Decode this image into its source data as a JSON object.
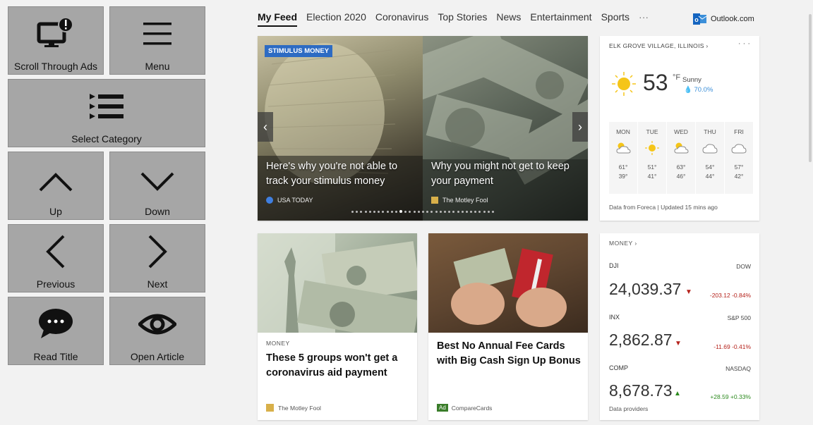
{
  "controls": {
    "scroll_ads": "Scroll Through Ads",
    "menu": "Menu",
    "select_category": "Select Category",
    "up": "Up",
    "down": "Down",
    "previous": "Previous",
    "next": "Next",
    "read_title": "Read Title",
    "open_article": "Open Article"
  },
  "nav": {
    "tabs": [
      "My Feed",
      "Election 2020",
      "Coronavirus",
      "Top Stories",
      "News",
      "Entertainment",
      "Sports"
    ],
    "more": "···",
    "outlook": "Outlook.com"
  },
  "hero": {
    "tag": "STIMULUS MONEY",
    "slide1_title": "Here's why you're not able to track your stimulus money",
    "slide1_source": "USA TODAY",
    "slide2_title": "Why you might not get to keep your payment",
    "slide2_source": "The Motley Fool",
    "prev": "‹",
    "next": "›"
  },
  "weather": {
    "location": "ELK GROVE VILLAGE, ILLINOIS  ›",
    "more": "· · ·",
    "temp": "53",
    "unit": "°F",
    "condition": "Sunny",
    "humidity": "💧 70.0%",
    "days": [
      {
        "name": "MON",
        "hi": "61°",
        "lo": "39°",
        "icon": "partly-sunny"
      },
      {
        "name": "TUE",
        "hi": "51°",
        "lo": "41°",
        "icon": "sunny"
      },
      {
        "name": "WED",
        "hi": "63°",
        "lo": "46°",
        "icon": "partly-sunny"
      },
      {
        "name": "THU",
        "hi": "54°",
        "lo": "44°",
        "icon": "cloudy"
      },
      {
        "name": "FRI",
        "hi": "57°",
        "lo": "42°",
        "icon": "cloudy"
      }
    ],
    "footer": "Data from Foreca | Updated 15 mins ago"
  },
  "articles": [
    {
      "category": "MONEY",
      "title": "These 5 groups won't get a coronavirus aid payment",
      "source": "The Motley Fool"
    },
    {
      "ad": "Ad",
      "title": "Best No Annual Fee Cards with Big Cash Sign Up Bonus",
      "source": "CompareCards"
    }
  ],
  "money": {
    "header": "MONEY  ›",
    "indices": [
      {
        "symbol": "DJI",
        "name": "DOW",
        "value": "24,039.37",
        "change": "-203.12  -0.84%",
        "dir": "down"
      },
      {
        "symbol": "INX",
        "name": "S&P 500",
        "value": "2,862.87",
        "change": "-11.69  -0.41%",
        "dir": "down"
      },
      {
        "symbol": "COMP",
        "name": "NASDAQ",
        "value": "8,678.73",
        "change": "+28.59  +0.33%",
        "dir": "up"
      }
    ],
    "providers": "Data providers"
  },
  "colors": {
    "tag": "#2d6bc3",
    "down": "#b5221b",
    "up": "#2c8a1e",
    "panel_button": "#a6a6a6"
  }
}
